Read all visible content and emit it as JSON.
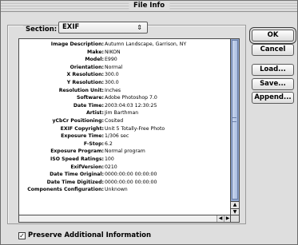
{
  "window": {
    "title": "File Info"
  },
  "section": {
    "label": "Section:",
    "selected": "EXIF",
    "arrows_glyph": "⇕"
  },
  "exif": {
    "rows": [
      {
        "label": "Image Description:",
        "value": "Autumn Landscape, Garrison, NY"
      },
      {
        "label": "Make:",
        "value": "NIKON"
      },
      {
        "label": "Model:",
        "value": "E990"
      },
      {
        "label": "Orientation:",
        "value": "Normal"
      },
      {
        "label": "X Resolution:",
        "value": "300.0"
      },
      {
        "label": "Y Resolution:",
        "value": "300.0"
      },
      {
        "label": "Resolution Unit:",
        "value": "Inches"
      },
      {
        "label": "Software:",
        "value": "Adobe Photoshop 7.0"
      },
      {
        "label": "Date Time:",
        "value": "2003:04:03 12:30:25"
      },
      {
        "label": "Artist:",
        "value": "Jim Barthman"
      },
      {
        "label": "yCbCr Positioning:",
        "value": "Cosited"
      },
      {
        "label": "EXIF Copyright:",
        "value": "Unit 5 Totally-Free Photo"
      },
      {
        "label": "Exposure Time:",
        "value": "1/306 sec"
      },
      {
        "label": "F-Stop:",
        "value": "6.2"
      },
      {
        "label": "Exposure Program:",
        "value": "Normal program"
      },
      {
        "label": "ISO Speed Ratings:",
        "value": "100"
      },
      {
        "label": "ExifVersion:",
        "value": "0210"
      },
      {
        "label": "Date Time Original:",
        "value": "0000:00:00 00:00:00"
      },
      {
        "label": "Date Time Digitized:",
        "value": "0000:00:00 00:00:00"
      },
      {
        "label": "Components Configuration:",
        "value": "Unknown"
      }
    ]
  },
  "buttons": {
    "ok": "OK",
    "cancel": "Cancel",
    "load": "Load...",
    "save": "Save...",
    "append": "Append..."
  },
  "checkbox": {
    "label": "Preserve Additional Information",
    "checked": true,
    "mark": "☑"
  },
  "scroll": {
    "up_glyph": "▲",
    "down_glyph": "▼",
    "left_glyph": "◀",
    "right_glyph": "▶"
  }
}
